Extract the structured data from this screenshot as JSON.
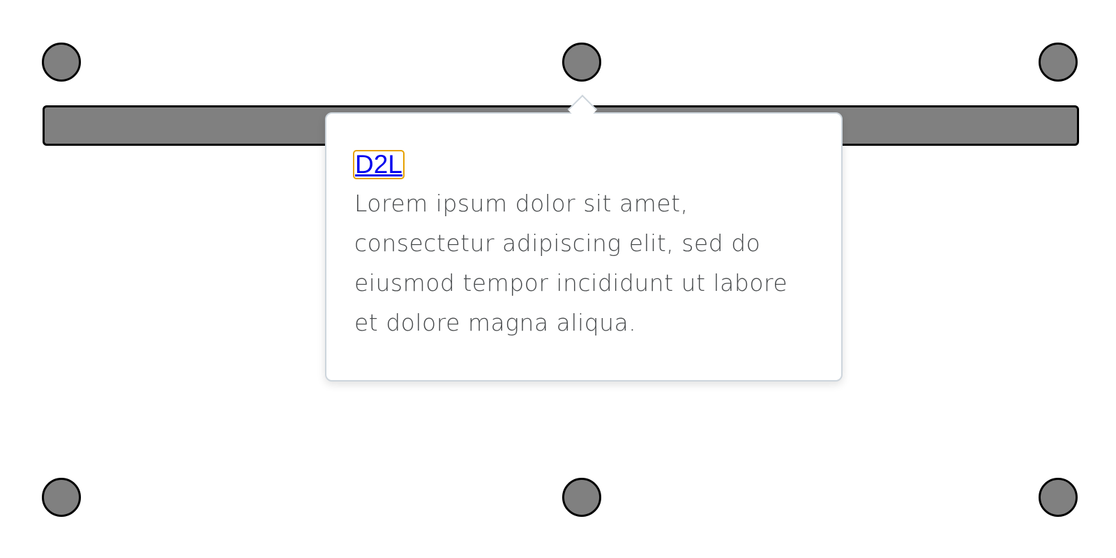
{
  "popover": {
    "link_label": "D2L",
    "body_text": "Lorem ipsum dolor sit amet, consectetur adipiscing elit, sed do eiusmod tempor incididunt ut labore et dolore magna aliqua."
  },
  "colors": {
    "dot_fill": "#808080",
    "outline": "#000000",
    "focus_ring": "#e6a100",
    "link": "#0000ee",
    "text": "#494c4e",
    "popover_border": "#cdd5dc"
  }
}
